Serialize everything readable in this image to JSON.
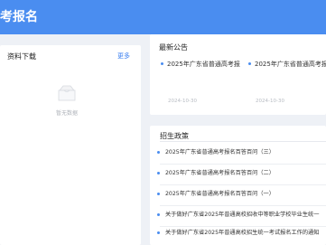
{
  "header": {
    "title": "考报名"
  },
  "downloads": {
    "title": "资料下载",
    "more": "更多",
    "empty_text": "暂无数据"
  },
  "news": {
    "title": "最新公告",
    "items": [
      {
        "title": "2025年广东省普通高考报",
        "date": "2024-10-30"
      },
      {
        "title": "2025年广东省普通高考报",
        "date": "2024-10-30"
      }
    ]
  },
  "policy": {
    "title": "招生政策",
    "items": [
      "2025年广东省普通高考报名百答百问（三）",
      "2025年广东省普通高考报名百答百问（二）",
      "2025年广东省普通高考报名百答百问（一）",
      "关于做好广东省2025年普通高校招收中等职业学校毕业生统一",
      "关于做好广东省2025年普通高校招生统一考试报名工作的通知"
    ]
  },
  "colors": {
    "header": "#4a8df0",
    "accent": "#3b7ff0"
  }
}
